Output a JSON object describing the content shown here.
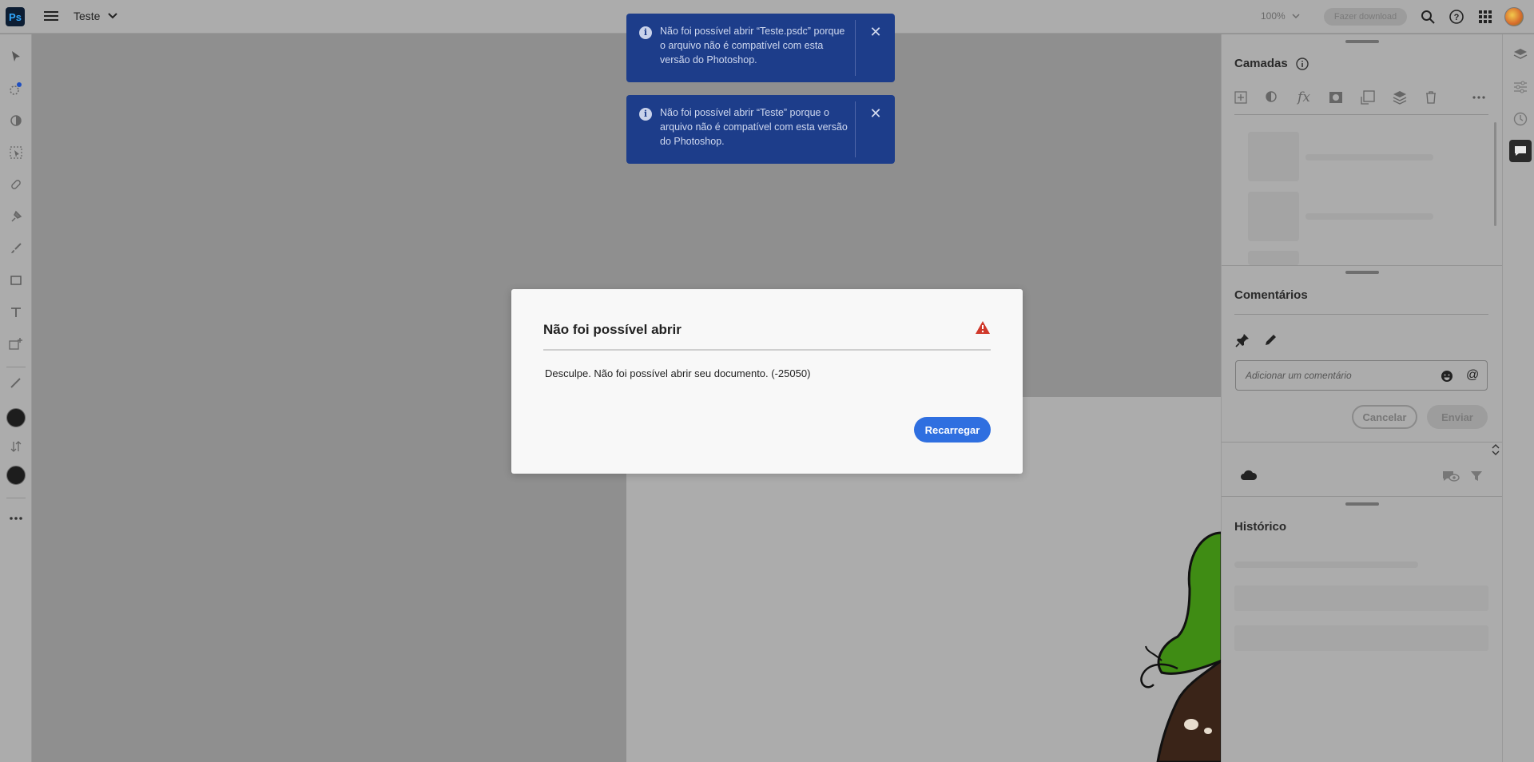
{
  "app": {
    "logo_text": "Ps",
    "document_title": "Teste",
    "zoom_level": "100%",
    "download_label": "Fazer download"
  },
  "toasts": [
    {
      "message": "Não foi possível abrir “Teste.psdc” porque o arquivo não é compatível com esta versão do Photoshop."
    },
    {
      "message": "Não foi possível abrir “Teste” porque o arquivo não é compatível com esta versão do Photoshop."
    }
  ],
  "dialog": {
    "title": "Não foi possível abrir",
    "body": "Desculpe. Não foi possível abrir seu documento. (-25050)",
    "reload_label": "Recarregar"
  },
  "layers_panel": {
    "title": "Camadas"
  },
  "comments_panel": {
    "title": "Comentários",
    "input_placeholder": "Adicionar um comentário",
    "cancel_label": "Cancelar",
    "send_label": "Enviar"
  },
  "history_panel": {
    "title": "Histórico"
  },
  "colors": {
    "toast_bg": "#1d3d8a",
    "primary_button": "#2f6fe0",
    "warning": "#d0392b",
    "ps_logo_bg": "#0c1d33",
    "ps_logo_fg": "#31a8ff"
  }
}
